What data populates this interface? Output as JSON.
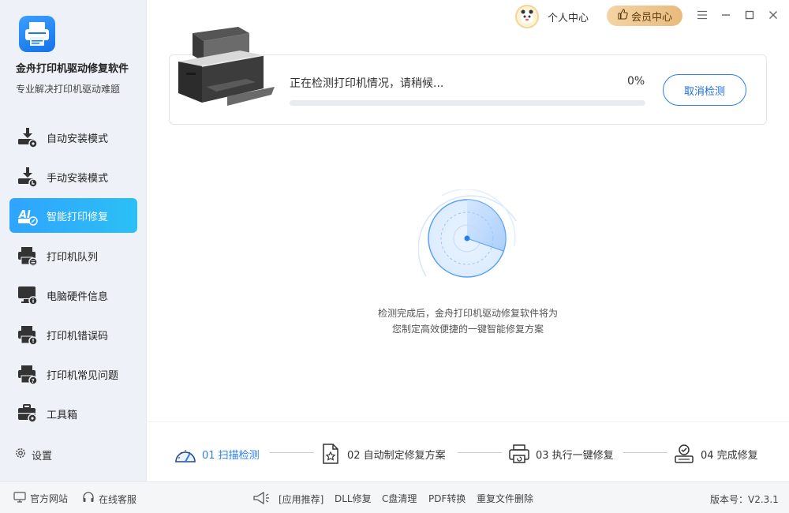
{
  "app": {
    "title": "金舟打印机驱动修复软件",
    "subtitle": "专业解决打印机驱动难题"
  },
  "sidebar": {
    "items": [
      {
        "label": "自动安装模式",
        "icon": "auto-install-icon",
        "active": false
      },
      {
        "label": "手动安装模式",
        "icon": "manual-install-icon",
        "active": false
      },
      {
        "label": "智能打印修复",
        "icon": "ai-repair-icon",
        "active": true
      },
      {
        "label": "打印机队列",
        "icon": "printer-queue-icon",
        "active": false
      },
      {
        "label": "电脑硬件信息",
        "icon": "hardware-info-icon",
        "active": false
      },
      {
        "label": "打印机错误码",
        "icon": "error-code-icon",
        "active": false
      },
      {
        "label": "打印机常见问题",
        "icon": "faq-icon",
        "active": false
      },
      {
        "label": "工具箱",
        "icon": "toolbox-icon",
        "active": false
      }
    ],
    "settings_label": "设置"
  },
  "topbar": {
    "user_center": "个人中心",
    "vip_center": "会员中心"
  },
  "scan": {
    "status_text": "正在检测打印机情况，请稍候...",
    "percent_text": "0%",
    "progress": 0,
    "cancel_label": "取消检测"
  },
  "description": {
    "line1": "检测完成后，金舟打印机驱动修复软件将为",
    "line2": "您制定高效便捷的一键智能修复方案"
  },
  "steps": [
    {
      "label": "01 扫描检测",
      "icon": "scan-gauge-icon",
      "active": true
    },
    {
      "label": "02 自动制定修复方案",
      "icon": "plan-document-icon",
      "active": false
    },
    {
      "label": "03 执行一键修复",
      "icon": "printer-repair-icon",
      "active": false
    },
    {
      "label": "04 完成修复",
      "icon": "check-complete-icon",
      "active": false
    }
  ],
  "footer": {
    "official_site": "官方网站",
    "online_service": "在线客服",
    "recommend": "[应用推荐]",
    "links": [
      "DLL修复",
      "C盘清理",
      "PDF转换",
      "重复文件删除"
    ],
    "version": "版本号：V2.3.1"
  },
  "colors": {
    "accent": "#2b7ff0",
    "sidebar_bg": "#eef2f8",
    "active_nav": "#2fa4ff",
    "vip": "#e9bb7c"
  }
}
